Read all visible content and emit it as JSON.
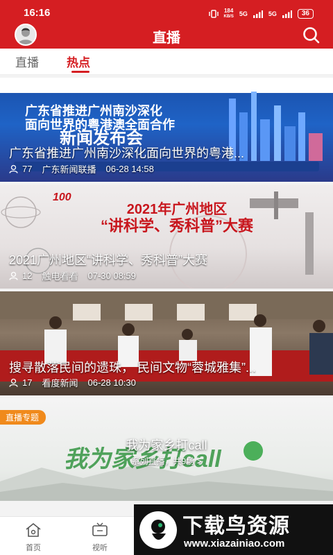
{
  "status_bar": {
    "time": "16:16",
    "speed_value": "184",
    "speed_unit": "KB/S",
    "net_1": "5G",
    "net_2": "5G",
    "battery": "36"
  },
  "app_bar": {
    "title": "直播"
  },
  "tabs": [
    {
      "label": "直播",
      "active": false
    },
    {
      "label": "热点",
      "active": true
    }
  ],
  "feed": [
    {
      "title": "广东省推进广州南沙深化面向世界的粤港...",
      "views": "77",
      "source": "广东新闻联播",
      "time": "06-28 14:58",
      "banner_head_1": "广东省推进广州南沙深化",
      "banner_head_2": "面向世界的粤港澳全面合作",
      "banner_head_3": "新闻发布会"
    },
    {
      "title": "2021广州地区“讲科学、秀科普”大赛",
      "views": "12",
      "source": "触电看看",
      "time": "07-30 08:59",
      "banner_head_1": "2021年广州地区",
      "banner_head_2": "“讲科学、秀科普”大赛",
      "banner_badge": "100"
    },
    {
      "title": "搜寻散落民间的遗珠， 民间文物“蓉城雅集”...",
      "views": "17",
      "source": "看度新闻",
      "time": "06-28 10:30"
    },
    {
      "tag": "直播专题",
      "title": "我为家乡打call",
      "subtitle": "系列直播，共9场 >",
      "art_text": "我为家乡打call"
    }
  ],
  "bottom_nav": [
    {
      "label": "首页",
      "icon": "home-icon"
    },
    {
      "label": "视听",
      "icon": "tv-icon"
    }
  ],
  "watermark": {
    "name": "下载鸟资源",
    "url": "www.xiazainiao.com"
  },
  "colors": {
    "brand_red": "#d51e22"
  }
}
